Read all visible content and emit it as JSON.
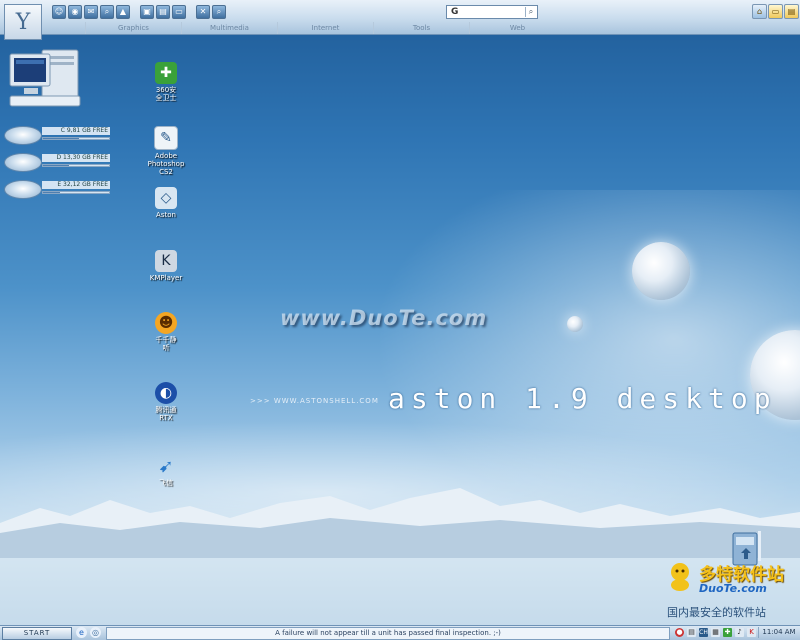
{
  "topbar": {
    "menu": [
      "Graphics",
      "Multimedia",
      "Internet",
      "Tools",
      "Web"
    ],
    "search_text": "G",
    "search_icon": "search-icon"
  },
  "drives": [
    {
      "label": "C 9,81 GB FREE",
      "used_fraction": 0.55
    },
    {
      "label": "D 13,30 GB FREE",
      "used_fraction": 0.4
    },
    {
      "label": "E 32,12 GB FREE",
      "used_fraction": 0.25
    }
  ],
  "desktop_icons": [
    {
      "label": "360安\n全卫士",
      "icon": "shield-icon",
      "color": "#3aa13a"
    },
    {
      "label": "Adobe\nPhotoshop\nCS2",
      "icon": "feather-icon",
      "color": "#eef4f8"
    },
    {
      "label": "Aston",
      "icon": "aston-icon",
      "color": "#d8e6f2"
    },
    {
      "label": "KMPlayer",
      "icon": "kmplayer-icon",
      "color": "#cfd8e2"
    },
    {
      "label": "千千静\n听",
      "icon": "ttplayer-icon",
      "color": "#f5a623"
    },
    {
      "label": "腾讯通\nRTX",
      "icon": "rtx-icon",
      "color": "#1c4fa8"
    },
    {
      "label": "飞信",
      "icon": "fetion-icon",
      "color": "#2a79c9"
    }
  ],
  "wallpaper": {
    "watermark": "www.DuoTe.com",
    "url_text": ">>> WWW.ASTONSHELL.COM",
    "brand_text": "aston 1.9 desktop"
  },
  "site_logo": {
    "line1": "多特软件站",
    "line2": "DuoTe.com",
    "line3": "国内最安全的软件站"
  },
  "taskbar": {
    "start_label": "START",
    "status_text": "A failure will not appear till a unit has passed final inspection. ;-)",
    "lang": "CH",
    "clock": "11:04 AM"
  },
  "colors": {
    "accent": "#3f6f9f",
    "taskbar": "#a9c3dc"
  }
}
